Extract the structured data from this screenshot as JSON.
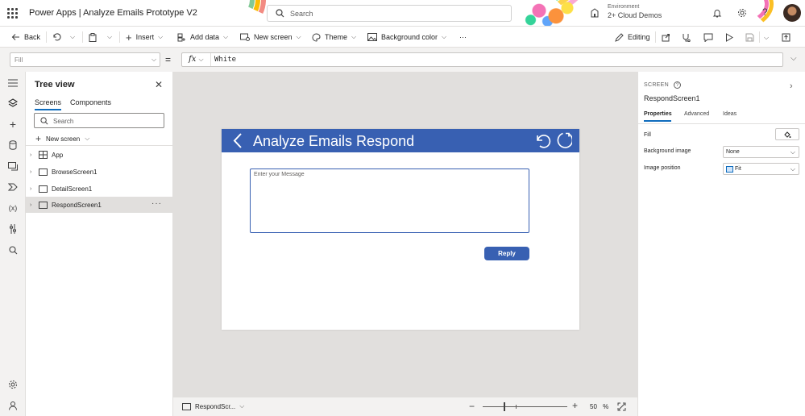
{
  "titlebar": {
    "app_title": "Power Apps  |  Analyze Emails Prototype V2",
    "search_placeholder": "Search",
    "environment_label": "Environment",
    "environment_name": "2+ Cloud Demos"
  },
  "commandbar": {
    "back": "Back",
    "insert": "Insert",
    "add_data": "Add data",
    "new_screen": "New screen",
    "theme": "Theme",
    "background_color": "Background color",
    "more": "···",
    "editing": "Editing"
  },
  "formulabar": {
    "property": "Fill",
    "equals": "=",
    "fx": "fx",
    "formula": "White"
  },
  "treeview": {
    "title": "Tree view",
    "tabs": [
      "Screens",
      "Components"
    ],
    "search_placeholder": "Search",
    "new_screen": "New screen",
    "items": [
      {
        "label": "App"
      },
      {
        "label": "BrowseScreen1"
      },
      {
        "label": "DetailScreen1"
      },
      {
        "label": "RespondScreen1",
        "selected": true
      }
    ],
    "more": "···"
  },
  "canvas": {
    "header_title": "Analyze Emails Respond",
    "message_placeholder": "Enter your Message",
    "reply_label": "Reply"
  },
  "statusbar": {
    "screen_name": "RespondScr...",
    "zoom": "50",
    "zoom_unit": "%"
  },
  "properties": {
    "type_label": "SCREEN",
    "screen_name": "RespondScreen1",
    "tabs": [
      "Properties",
      "Advanced",
      "Ideas"
    ],
    "fill_label": "Fill",
    "background_image_label": "Background image",
    "background_image_value": "None",
    "image_position_label": "Image position",
    "image_position_value": "Fit"
  },
  "colors": {
    "header_blue": "#3860b2",
    "accent": "#0f6cbd",
    "selected_row": "#e1dfdd"
  }
}
